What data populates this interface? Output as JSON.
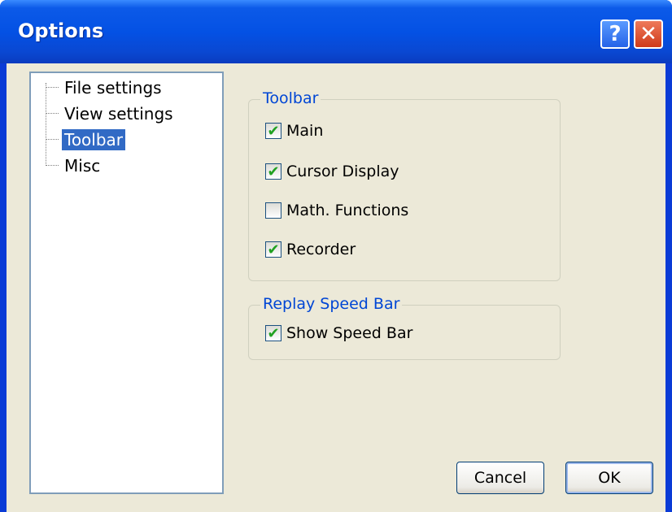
{
  "window": {
    "title": "Options"
  },
  "title_buttons": {
    "help": "?",
    "close": "✕"
  },
  "tree": {
    "items": [
      {
        "label": "File settings",
        "selected": false
      },
      {
        "label": "View settings",
        "selected": false
      },
      {
        "label": "Toolbar",
        "selected": true
      },
      {
        "label": "Misc",
        "selected": false
      }
    ]
  },
  "toolbar_group": {
    "title": "Toolbar",
    "checkboxes": [
      {
        "label": "Main",
        "checked": true
      },
      {
        "label": "Cursor Display",
        "checked": true
      },
      {
        "label": "Math. Functions",
        "checked": false
      },
      {
        "label": "Recorder",
        "checked": true
      }
    ]
  },
  "speed_group": {
    "title": "Replay Speed Bar",
    "checkboxes": [
      {
        "label": "Show Speed Bar",
        "checked": true
      }
    ]
  },
  "buttons": {
    "cancel": "Cancel",
    "ok": "OK"
  },
  "colors": {
    "titlebar": "#0451e4",
    "group_title": "#0046d5",
    "selection": "#316ac5",
    "check": "#21a121"
  }
}
